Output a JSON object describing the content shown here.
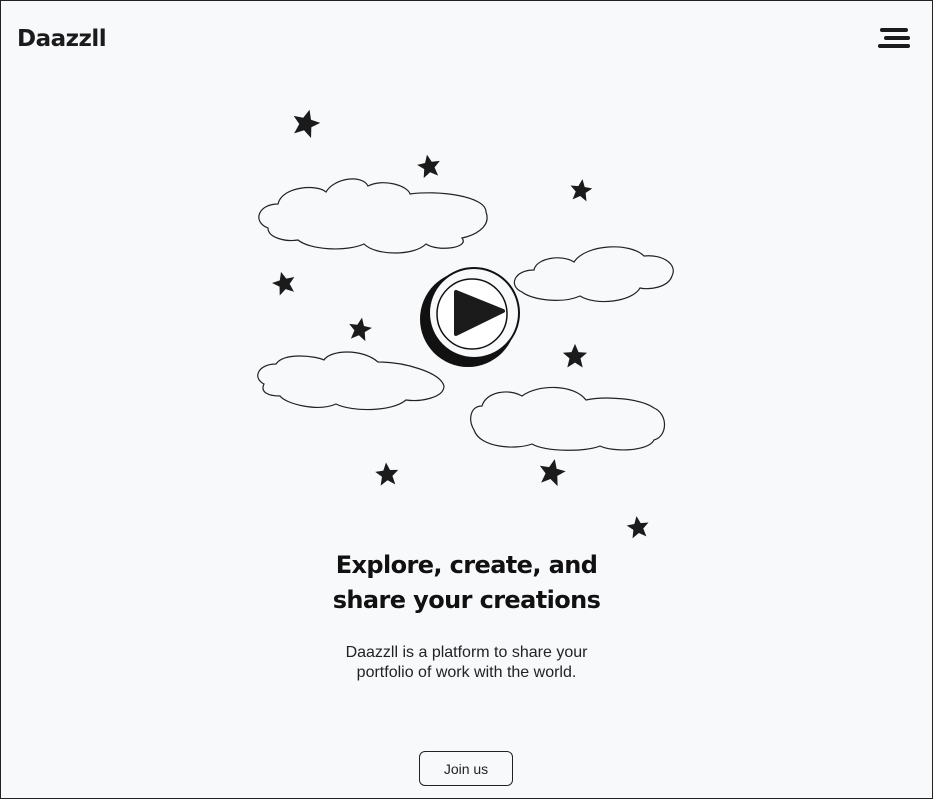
{
  "brand": {
    "name": "Daazzll"
  },
  "header": {
    "menu_icon": "hamburger-menu-icon"
  },
  "hero": {
    "illustration_icon": "play-button-icon",
    "headline_line1": "Explore, create, and",
    "headline_line2": "share your creations",
    "description": "Daazzll is a platform to share your portfolio of work with the world.",
    "cta_label": "Join us"
  },
  "colors": {
    "background": "#f8f9fb",
    "ink": "#1b1b1b"
  }
}
